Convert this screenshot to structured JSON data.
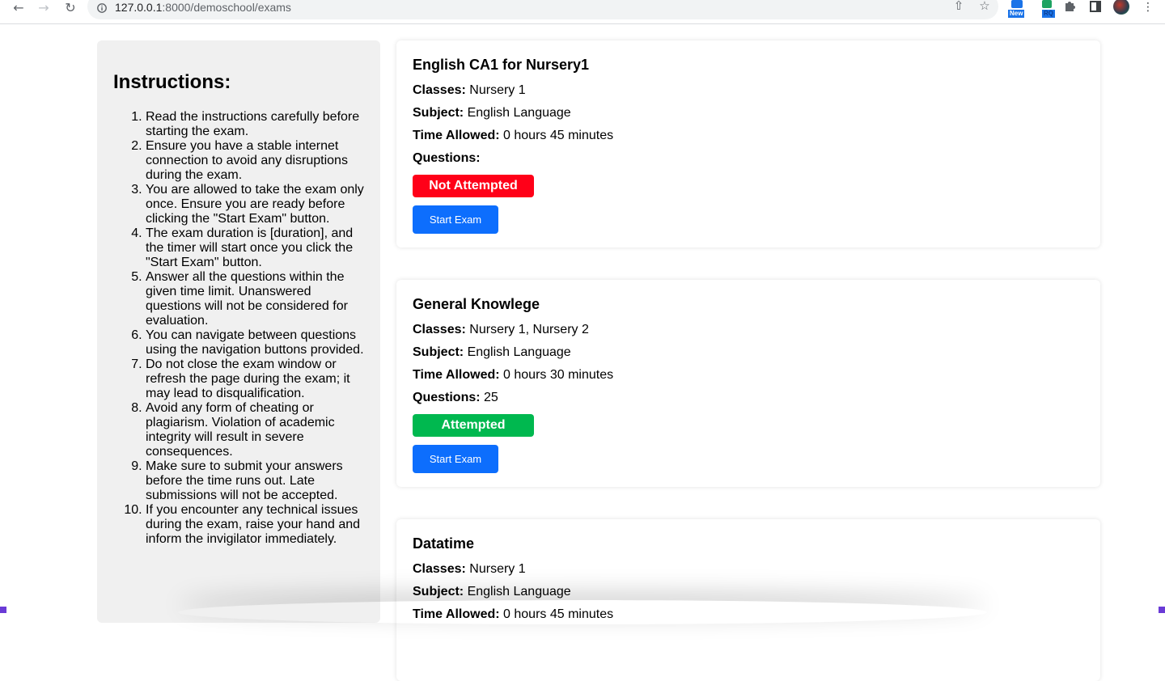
{
  "browser": {
    "url_host": "127.0.0.1",
    "url_path": ":8000/demoschool/exams",
    "ext_new_badge": "New",
    "ext_rq_badge": "RQ",
    "icons": [
      "back-arrow-icon",
      "forward-arrow-icon",
      "reload-icon",
      "info-icon",
      "share-icon",
      "star-icon",
      "extensions-puzzle-icon",
      "sidebar-panel-icon",
      "profile-avatar",
      "kebab-menu-icon"
    ]
  },
  "sidebar": {
    "title": "Instructions:",
    "items": [
      "Read the instructions carefully before starting the exam.",
      "Ensure you have a stable internet connection to avoid any disruptions during the exam.",
      "You are allowed to take the exam only once. Ensure you are ready before clicking the \"Start Exam\" button.",
      "The exam duration is [duration], and the timer will start once you click the \"Start Exam\" button.",
      "Answer all the questions within the given time limit. Unanswered questions will not be considered for evaluation.",
      "You can navigate between questions using the navigation buttons provided.",
      "Do not close the exam window or refresh the page during the exam; it may lead to disqualification.",
      "Avoid any form of cheating or plagiarism. Violation of academic integrity will result in severe consequences.",
      "Make sure to submit your answers before the time runs out. Late submissions will not be accepted.",
      "If you encounter any technical issues during the exam, raise your hand and inform the invigilator immediately."
    ]
  },
  "labels": {
    "classes": "Classes:",
    "subject": "Subject:",
    "time": "Time Allowed:",
    "questions": "Questions:",
    "start": "Start Exam"
  },
  "exams": [
    {
      "title": "English CA1 for Nursery1",
      "classes": "Nursery 1",
      "subject": "English Language",
      "time": "0 hours 45 minutes",
      "questions": "",
      "status": "Not Attempted",
      "status_color": "#ff0018"
    },
    {
      "title": "General Knowlege",
      "classes": "Nursery 1, Nursery 2",
      "subject": "English Language",
      "time": "0 hours 30 minutes",
      "questions": "25",
      "status": "Attempted",
      "status_color": "#00b84f"
    },
    {
      "title": "Datatime",
      "classes": "Nursery 1",
      "subject": "English Language",
      "time": "0 hours 45 minutes"
    }
  ],
  "colors": {
    "accent": "#0d6efd",
    "sidebar_bg": "#f0f0f0"
  }
}
